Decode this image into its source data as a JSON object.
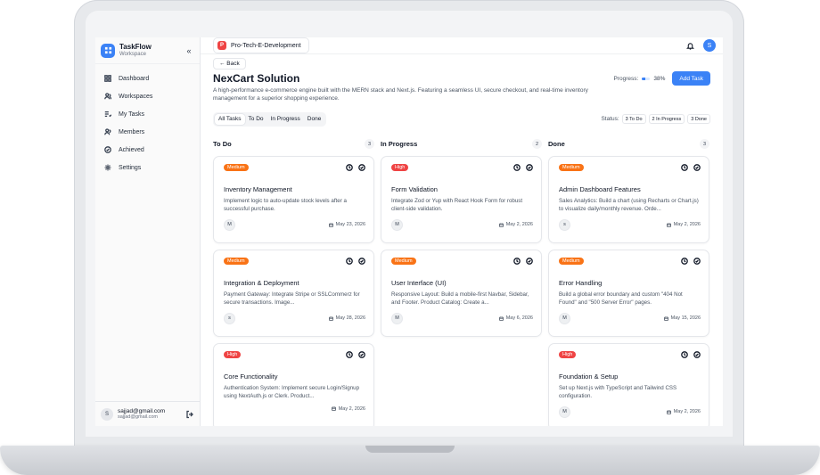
{
  "sidebar": {
    "brand_title": "TaskFlow",
    "brand_subtitle": "Workspace",
    "collapse_label": "«",
    "items": [
      {
        "label": "Dashboard",
        "icon": "dashboard-icon"
      },
      {
        "label": "Workspaces",
        "icon": "workspaces-icon"
      },
      {
        "label": "My Tasks",
        "icon": "tasks-icon"
      },
      {
        "label": "Members",
        "icon": "members-icon"
      },
      {
        "label": "Achieved",
        "icon": "achieved-icon"
      },
      {
        "label": "Settings",
        "icon": "settings-icon"
      }
    ],
    "user": {
      "initial": "S",
      "name": "sajjad@gmail.com",
      "email": "sajjad@gmail.com"
    }
  },
  "topbar": {
    "project_initial": "P",
    "project_name": "Pro-Tech-E-Development",
    "avatar_initial": "S"
  },
  "header": {
    "back_label": "← Back",
    "title": "NexCart Solution",
    "description": "A high-performance e-commerce engine built with the MERN stack and Next.js. Featuring a seamless UI, secure checkout, and real-time inventory management for a superior shopping experience.",
    "progress_label": "Progress:",
    "progress_value": 38,
    "progress_text": "38%",
    "add_task_label": "Add Task"
  },
  "filters": {
    "tabs": [
      "All Tasks",
      "To Do",
      "In Progress",
      "Done"
    ],
    "active": "All Tasks",
    "status_label": "Status:",
    "status_chips": [
      "3 To Do",
      "2 In Progress",
      "3 Done"
    ]
  },
  "colors": {
    "accent": "#3b82f6",
    "medium": "#f97316",
    "high": "#ef4444"
  },
  "columns": [
    {
      "title": "To Do",
      "count": "3",
      "cards": [
        {
          "priority": "Medium",
          "title": "Inventory Management",
          "description": "Implement logic to auto-update stock levels after a successful purchase.",
          "assignee": "M",
          "date": "May 23, 2026"
        },
        {
          "priority": "Medium",
          "title": "Integration & Deployment",
          "description": "Payment Gateway: Integrate Stripe or SSLCommerz for secure transactions. Image...",
          "assignee": "s",
          "date": "May 28, 2026"
        },
        {
          "priority": "High",
          "title": "Core Functionality",
          "description": "Authentication System: Implement secure Login/Signup using NextAuth.js or Clerk. Product...",
          "assignee": "",
          "date": "May 2, 2026"
        }
      ]
    },
    {
      "title": "In Progress",
      "count": "2",
      "cards": [
        {
          "priority": "High",
          "title": "Form Validation",
          "description": "Integrate Zod or Yup with React Hook Form for robust client-side validation.",
          "assignee": "M",
          "date": "May 2, 2026"
        },
        {
          "priority": "Medium",
          "title": "User Interface (UI)",
          "description": "Responsive Layout: Build a mobile-first Navbar, Sidebar, and Footer. Product Catalog: Create a...",
          "assignee": "M",
          "date": "May 6, 2026"
        }
      ]
    },
    {
      "title": "Done",
      "count": "3",
      "cards": [
        {
          "priority": "Medium",
          "title": "Admin Dashboard Features",
          "description": "Sales Analytics: Build a chart (using Recharts or Chart.js) to visualize daily/monthly revenue. Orde...",
          "assignee": "s",
          "date": "May 2, 2026"
        },
        {
          "priority": "Medium",
          "title": "Error Handling",
          "description": "Build a global error boundary and custom \"404 Not Found\" and \"500 Server Error\" pages.",
          "assignee": "M",
          "date": "May 15, 2026"
        },
        {
          "priority": "High",
          "title": "Foundation & Setup",
          "description": "Set up Next.js with TypeScript and Tailwind CSS configuration.",
          "assignee": "M",
          "date": "May 2, 2026"
        }
      ]
    }
  ]
}
